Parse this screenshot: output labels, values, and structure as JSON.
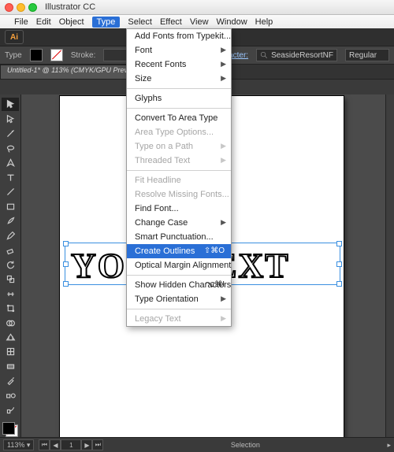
{
  "mac": {
    "app_name": "Illustrator CC"
  },
  "menubar": {
    "items": [
      "File",
      "Edit",
      "Object",
      "Type",
      "Select",
      "Effect",
      "View",
      "Window",
      "Help"
    ],
    "open_index": 3
  },
  "toolbar": {
    "type_label": "Type",
    "stroke_label": "Stroke:",
    "character_link": "Character:",
    "font_name": "SeasideResortNF",
    "font_style": "Regular"
  },
  "doc_tab": "Untitled-1* @ 113% (CMYK/GPU Preview)",
  "dropdown": {
    "items": [
      {
        "label": "Add Fonts from Typekit..."
      },
      {
        "label": "Font",
        "sub": true
      },
      {
        "label": "Recent Fonts",
        "sub": true
      },
      {
        "label": "Size",
        "sub": true
      },
      {
        "sep": true
      },
      {
        "label": "Glyphs"
      },
      {
        "sep": true
      },
      {
        "label": "Convert To Area Type"
      },
      {
        "label": "Area Type Options...",
        "disabled": true
      },
      {
        "label": "Type on a Path",
        "sub": true,
        "disabled": true
      },
      {
        "label": "Threaded Text",
        "sub": true,
        "disabled": true
      },
      {
        "sep": true
      },
      {
        "label": "Fit Headline",
        "disabled": true
      },
      {
        "label": "Resolve Missing Fonts...",
        "disabled": true
      },
      {
        "label": "Find Font..."
      },
      {
        "label": "Change Case",
        "sub": true
      },
      {
        "label": "Smart Punctuation..."
      },
      {
        "label": "Create Outlines",
        "hi": true,
        "shortcut": "⇧⌘O"
      },
      {
        "label": "Optical Margin Alignment"
      },
      {
        "sep": true
      },
      {
        "label": "Show Hidden Characters",
        "shortcut": "⌥⌘I"
      },
      {
        "label": "Type Orientation",
        "sub": true
      },
      {
        "sep": true
      },
      {
        "label": "Legacy Text",
        "sub": true,
        "disabled": true
      }
    ]
  },
  "canvas": {
    "sample_text": "YOUR TEXT"
  },
  "statusbar": {
    "zoom": "113%",
    "artboard_nav": "1",
    "mode": "Selection"
  },
  "icons": {
    "search": "search-icon",
    "ai": "Ai"
  }
}
